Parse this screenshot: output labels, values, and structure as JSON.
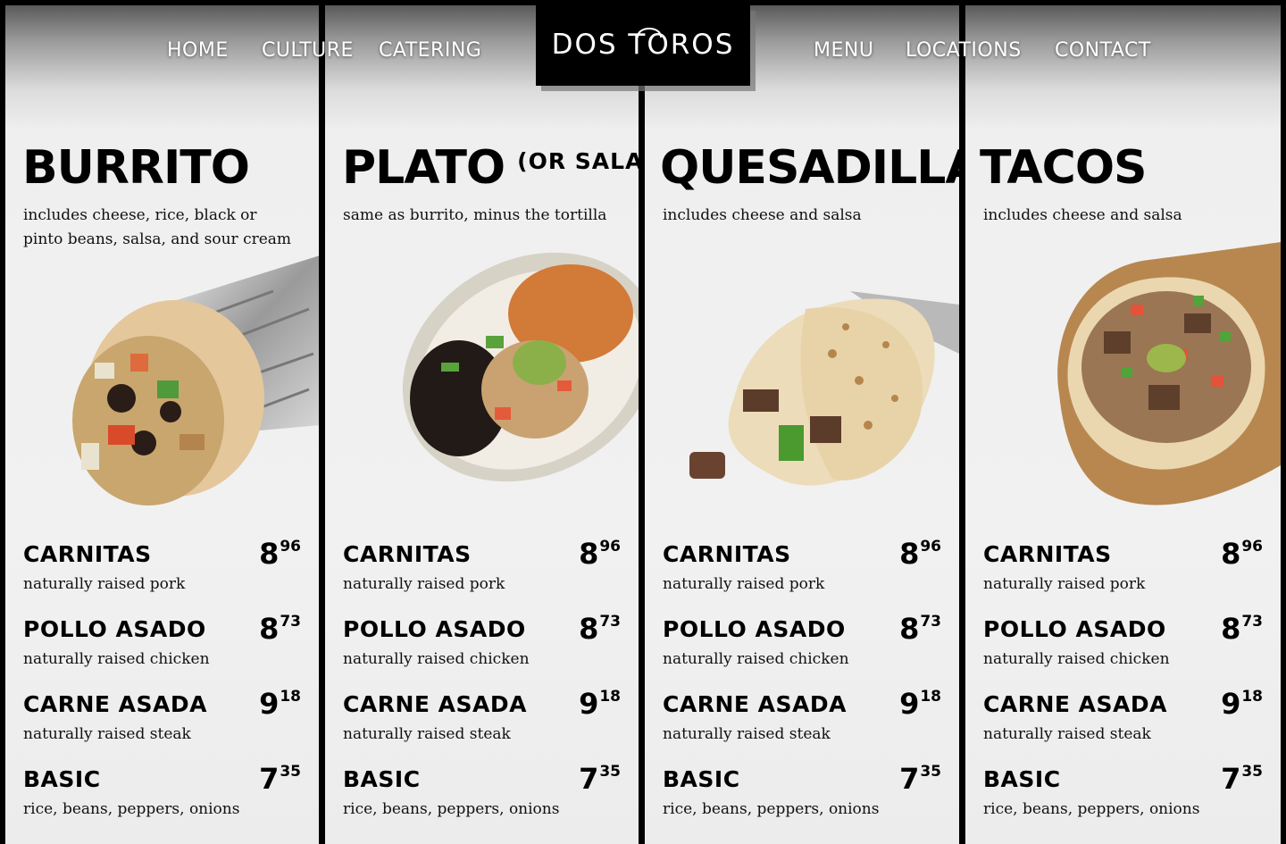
{
  "nav": {
    "left": [
      "HOME",
      "CULTURE",
      "CATERING"
    ],
    "right": [
      "MENU",
      "LOCATIONS",
      "CONTACT"
    ],
    "logo": "DOS TOROS"
  },
  "columns": [
    {
      "title": "BURRITO",
      "subtitle": "",
      "description": "includes cheese, rice, black or pinto beans, salsa, and sour cream",
      "image": "burrito-image",
      "items": [
        {
          "name": "CARNITAS",
          "desc": "naturally raised pork",
          "dollars": "8",
          "cents": "96"
        },
        {
          "name": "POLLO ASADO",
          "desc": "naturally raised chicken",
          "dollars": "8",
          "cents": "73"
        },
        {
          "name": "CARNE ASADA",
          "desc": "naturally raised steak",
          "dollars": "9",
          "cents": "18"
        },
        {
          "name": "BASIC",
          "desc": "rice, beans, peppers, onions",
          "dollars": "7",
          "cents": "35"
        }
      ]
    },
    {
      "title": "PLATO",
      "subtitle": "(OR SALAD)",
      "description": "same as burrito, minus the tortilla",
      "image": "plato-bowl-image",
      "items": [
        {
          "name": "CARNITAS",
          "desc": "naturally raised pork",
          "dollars": "8",
          "cents": "96"
        },
        {
          "name": "POLLO ASADO",
          "desc": "naturally raised chicken",
          "dollars": "8",
          "cents": "73"
        },
        {
          "name": "CARNE ASADA",
          "desc": "naturally raised steak",
          "dollars": "9",
          "cents": "18"
        },
        {
          "name": "BASIC",
          "desc": "rice, beans, peppers, onions",
          "dollars": "7",
          "cents": "35"
        }
      ]
    },
    {
      "title": "QUESADILLA",
      "subtitle": "",
      "description": "includes cheese and salsa",
      "image": "quesadilla-image",
      "items": [
        {
          "name": "CARNITAS",
          "desc": "naturally raised pork",
          "dollars": "8",
          "cents": "96"
        },
        {
          "name": "POLLO ASADO",
          "desc": "naturally raised chicken",
          "dollars": "8",
          "cents": "73"
        },
        {
          "name": "CARNE ASADA",
          "desc": "naturally raised steak",
          "dollars": "9",
          "cents": "18"
        },
        {
          "name": "BASIC",
          "desc": "rice, beans, peppers, onions",
          "dollars": "7",
          "cents": "35"
        }
      ]
    },
    {
      "title": "TACOS",
      "subtitle": "",
      "description": "includes cheese and salsa",
      "image": "tacos-image",
      "items": [
        {
          "name": "CARNITAS",
          "desc": "naturally raised pork",
          "dollars": "8",
          "cents": "96"
        },
        {
          "name": "POLLO ASADO",
          "desc": "naturally raised chicken",
          "dollars": "8",
          "cents": "73"
        },
        {
          "name": "CARNE ASADA",
          "desc": "naturally raised steak",
          "dollars": "9",
          "cents": "18"
        },
        {
          "name": "BASIC",
          "desc": "rice, beans, peppers, onions",
          "dollars": "7",
          "cents": "35"
        }
      ]
    }
  ],
  "colors": {
    "background": "#000000",
    "panel": "#efefef",
    "text": "#000000",
    "nav_text": "#ffffff"
  }
}
